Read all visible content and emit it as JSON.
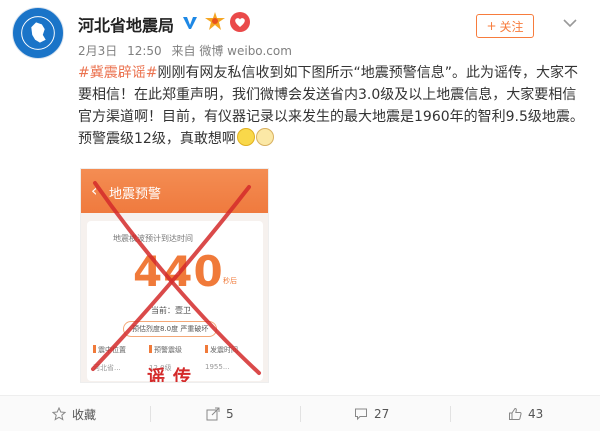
{
  "account": {
    "name": "河北省地震局",
    "date": "2月3日",
    "time": "12:50",
    "source": "来自 微博 weibo.com",
    "follow_label": "关注"
  },
  "post": {
    "tag": "#冀震辟谣#",
    "text": "刚刚有网友私信收到如下图所示“地震预警信息”。此为谣传，大家不要相信！在此郑重声明，我们微博会发送省内3.0级及以上地震信息，大家要相信官方渠道啊！目前，有仪器记录以来发生的最大地震是1960年的智利9.5级地震。预警震级12级，真敢想啊"
  },
  "screenshot": {
    "header_title": "地震预警",
    "subtitle": "地震横波预计到达时间",
    "countdown": "440",
    "countdown_unit": "秒后",
    "location": "当前：壹卫",
    "prediction": "预估烈度8.0度 严重破坏",
    "stats": [
      {
        "label": "震中位置",
        "value": "河北省..."
      },
      {
        "label": "预警震级",
        "value": "12.0级"
      },
      {
        "label": "发震时间",
        "value": "1955..."
      }
    ],
    "stamp": "谣传"
  },
  "actions": {
    "favorite": "收藏",
    "forward": "5",
    "comments": "27",
    "likes": "43"
  },
  "colors": {
    "accent": "#eb7350",
    "follow": "#f77c3d",
    "cross": "#d42a2a"
  }
}
